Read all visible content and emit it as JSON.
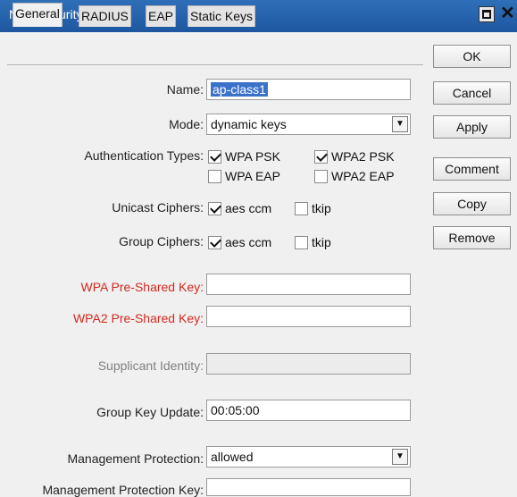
{
  "window": {
    "title": "New Security Profile"
  },
  "tabs": [
    "General",
    "RADIUS",
    "EAP",
    "Static Keys"
  ],
  "form": {
    "name_label": "Name:",
    "name_value": "ap-class1",
    "mode_label": "Mode:",
    "mode_value": "dynamic keys",
    "auth_label": "Authentication Types:",
    "auth": {
      "wpa_psk": "WPA PSK",
      "wpa2_psk": "WPA2 PSK",
      "wpa_eap": "WPA EAP",
      "wpa2_eap": "WPA2 EAP"
    },
    "unicast_label": "Unicast Ciphers:",
    "group_label": "Group Ciphers:",
    "cipher_aes": "aes ccm",
    "cipher_tkip": "tkip",
    "wpa_key_label": "WPA Pre-Shared Key:",
    "wpa2_key_label": "WPA2 Pre-Shared Key:",
    "supplicant_label": "Supplicant Identity:",
    "group_key_update_label": "Group Key Update:",
    "group_key_update_value": "00:05:00",
    "mgmt_protection_label": "Management Protection:",
    "mgmt_protection_value": "allowed",
    "mgmt_protection_key_label": "Management Protection Key:"
  },
  "buttons": {
    "ok": "OK",
    "cancel": "Cancel",
    "apply": "Apply",
    "comment": "Comment",
    "copy": "Copy",
    "remove": "Remove"
  },
  "colors": {
    "titlebar": "#2a66b0",
    "required_label": "#d4291e",
    "selection": "#3b72c9"
  },
  "icons": {
    "maximize": "maximize-icon",
    "close": "close-icon",
    "dropdown": "dropdown-arrow-icon"
  }
}
